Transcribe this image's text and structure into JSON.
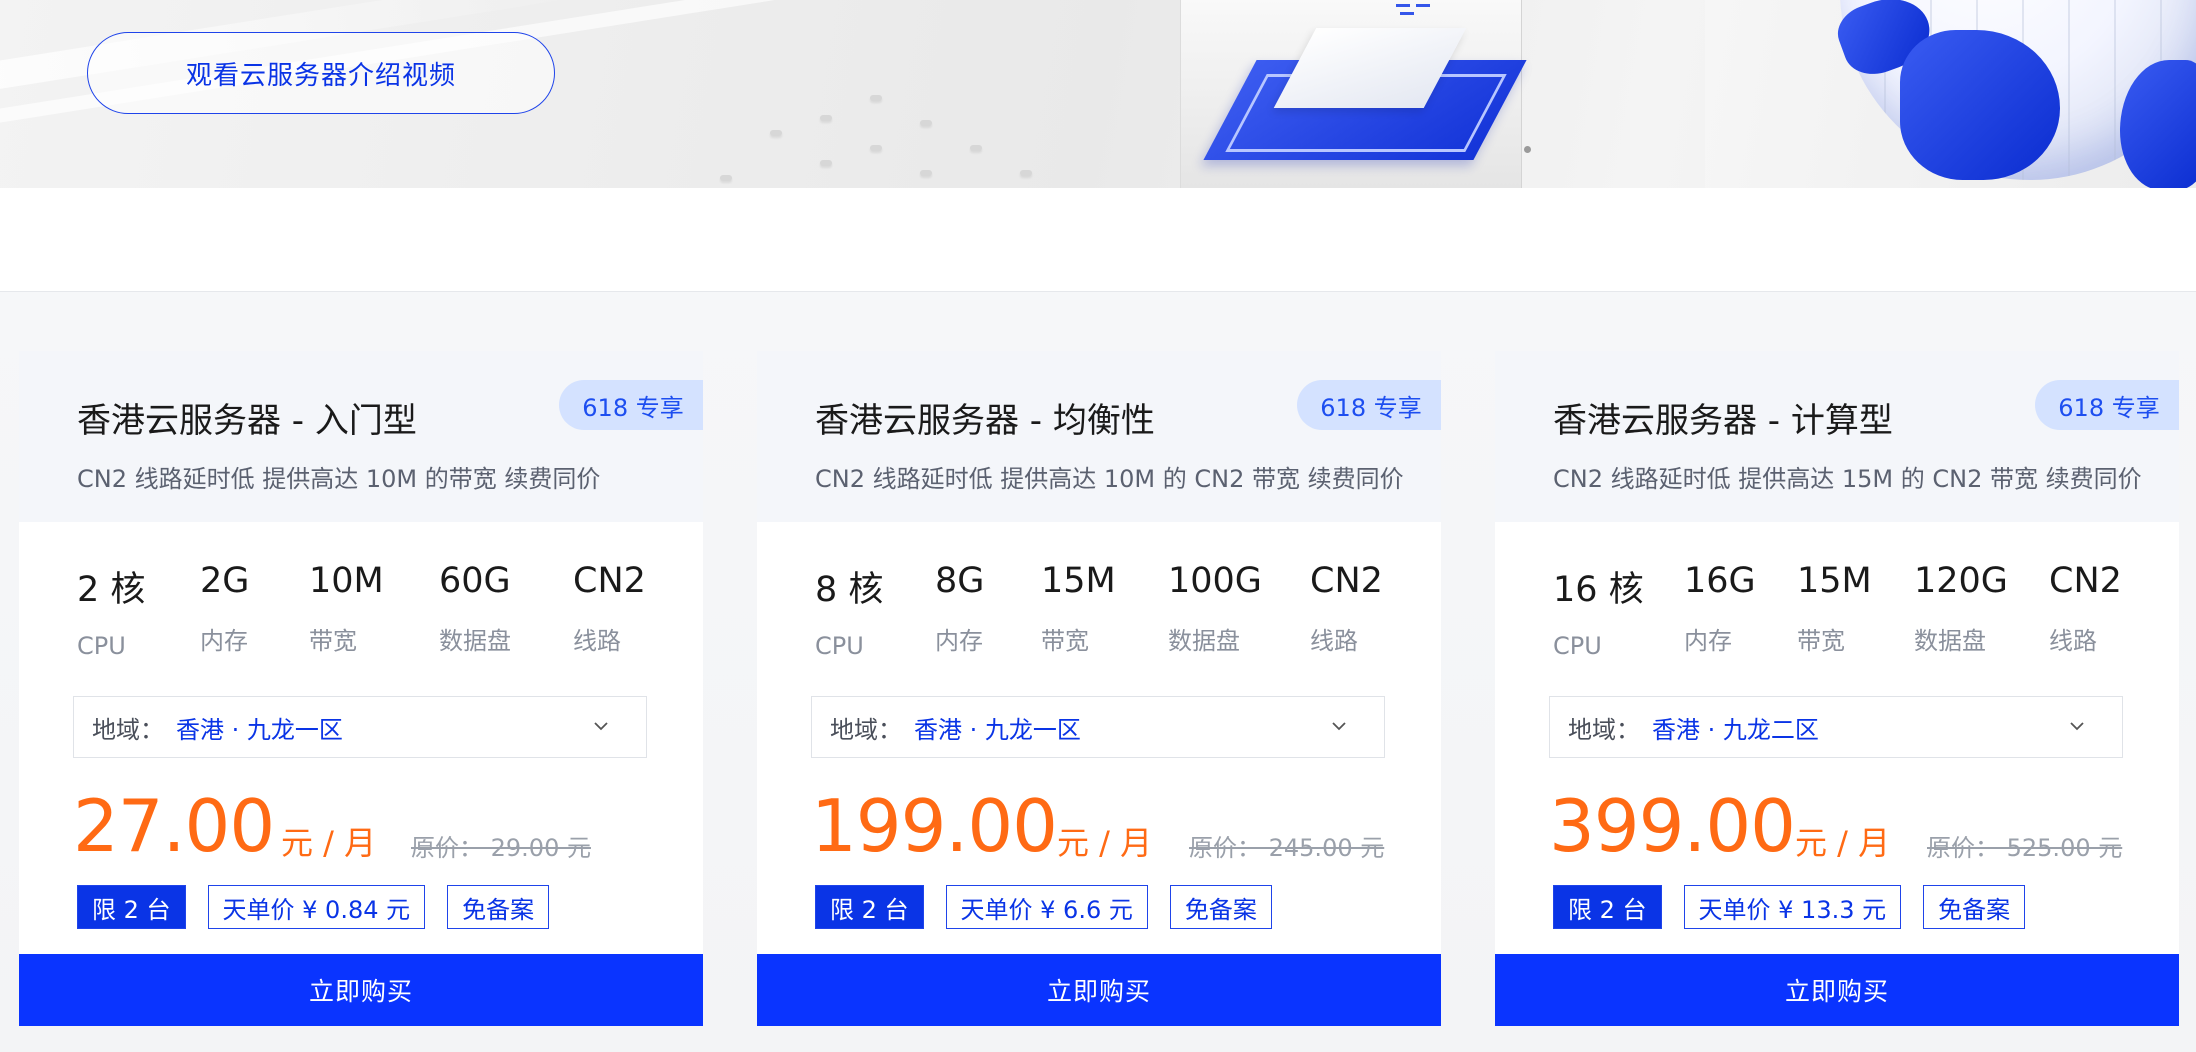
{
  "banner": {
    "video_button": "观看云服务器介绍视频"
  },
  "cards": [
    {
      "title": "香港云服务器 - 入门型",
      "subtitle": "CN2 线路延时低 提供高达 10M 的带宽 续费同价",
      "tag": "618 专享",
      "specs": [
        {
          "value": "2 核",
          "label": "CPU"
        },
        {
          "value": "2G",
          "label": "内存"
        },
        {
          "value": "10M",
          "label": "带宽"
        },
        {
          "value": "60G",
          "label": "数据盘"
        },
        {
          "value": "CN2",
          "label": "线路"
        }
      ],
      "region_label": "地域：",
      "region_value": "香港 · 九龙一区",
      "price": "27.00",
      "unit": "元 / 月",
      "original_price": "原价： 29.00 元",
      "badges": [
        "限 2 台",
        "天单价 ¥ 0.84 元",
        "免备案"
      ],
      "buy_label": "立即购买"
    },
    {
      "title": "香港云服务器 - 均衡性",
      "subtitle": "CN2 线路延时低 提供高达 10M 的 CN2 带宽 续费同价",
      "tag": "618 专享",
      "specs": [
        {
          "value": "8 核",
          "label": "CPU"
        },
        {
          "value": "8G",
          "label": "内存"
        },
        {
          "value": "15M",
          "label": "带宽"
        },
        {
          "value": "100G",
          "label": "数据盘"
        },
        {
          "value": "CN2",
          "label": "线路"
        }
      ],
      "region_label": "地域：",
      "region_value": "香港 · 九龙一区",
      "price": "199.00",
      "unit": "元 / 月",
      "original_price": "原价： 245.00 元",
      "badges": [
        "限 2 台",
        "天单价 ¥ 6.6 元",
        "免备案"
      ],
      "buy_label": "立即购买"
    },
    {
      "title": "香港云服务器 - 计算型",
      "subtitle": "CN2 线路延时低 提供高达 15M 的 CN2 带宽 续费同价",
      "tag": "618 专享",
      "specs": [
        {
          "value": "16 核",
          "label": "CPU"
        },
        {
          "value": "16G",
          "label": "内存"
        },
        {
          "value": "15M",
          "label": "带宽"
        },
        {
          "value": "120G",
          "label": "数据盘"
        },
        {
          "value": "CN2",
          "label": "线路"
        }
      ],
      "region_label": "地域：",
      "region_value": "香港 · 九龙二区",
      "price": "399.00",
      "unit": "元 / 月",
      "original_price": "原价： 525.00 元",
      "badges": [
        "限 2 台",
        "天单价 ¥ 13.3 元",
        "免备案"
      ],
      "buy_label": "立即购买"
    }
  ]
}
